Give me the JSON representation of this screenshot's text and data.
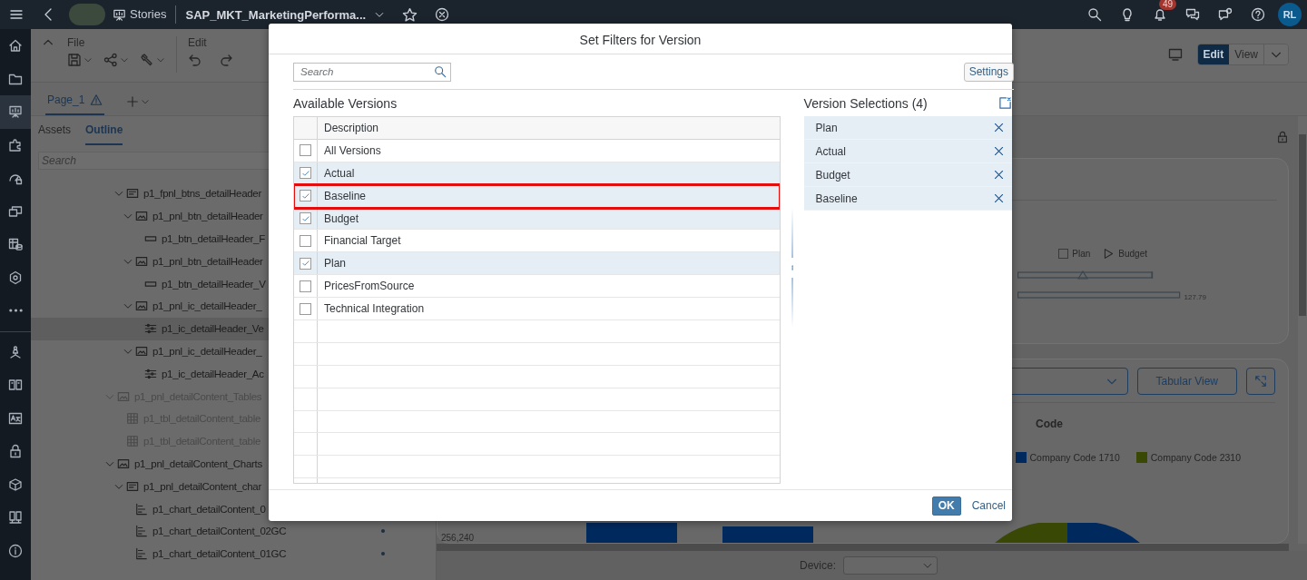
{
  "shell": {
    "section": "Stories",
    "story": "SAP_MKT_MarketingPerforma...",
    "notifications": "49",
    "avatar": "RL"
  },
  "rail": {
    "items": [
      {
        "selected": false
      },
      {
        "selected": false
      },
      {
        "selected": true
      },
      {
        "selected": false
      },
      {
        "selected": false
      },
      {
        "selected": false
      },
      {
        "selected": false
      },
      {
        "selected": false
      },
      {
        "selected": false
      },
      {
        "selected": false
      },
      {
        "selected": false
      },
      {
        "selected": false
      },
      {
        "selected": false
      },
      {
        "selected": false
      },
      {
        "selected": false
      },
      {
        "selected": false
      }
    ]
  },
  "toolbar": {
    "groups": [
      {
        "label": "File"
      },
      {
        "label": "Edit"
      }
    ],
    "modes": [
      {
        "label": "Edit",
        "selected": true
      },
      {
        "label": "View",
        "selected": false
      }
    ]
  },
  "page_tabs": [
    {
      "label": "Page_1",
      "warning": true,
      "selected": true
    }
  ],
  "panel": {
    "tabs": [
      {
        "label": "Assets",
        "selected": false
      },
      {
        "label": "Outline",
        "selected": true
      }
    ],
    "search": {
      "placeholder": "Search"
    },
    "tree": [
      {
        "children": [
          {
            "label": "p1_fpnl_btns_detailHeader",
            "kind": "flexpanel",
            "expanded": true,
            "dimmed": false,
            "selected": false,
            "children": [
              {
                "label": "p1_pnl_btn_detailHeader",
                "kind": "panel",
                "expanded": true,
                "dimmed": false,
                "selected": false,
                "children": [
                  {
                    "label": "p1_btn_detailHeader_F",
                    "kind": "button",
                    "dimmed": false,
                    "selected": false
                  }
                ]
              },
              {
                "label": "p1_pnl_btn_detailHeader",
                "kind": "panel",
                "expanded": true,
                "dimmed": false,
                "selected": false,
                "children": [
                  {
                    "label": "p1_btn_detailHeader_V",
                    "kind": "button",
                    "dimmed": false,
                    "selected": false
                  }
                ]
              },
              {
                "label": "p1_pnl_ic_detailHeader_",
                "kind": "panel",
                "expanded": true,
                "dimmed": false,
                "selected": false,
                "children": [
                  {
                    "label": "p1_ic_detailHeader_Ve",
                    "kind": "control",
                    "dimmed": false,
                    "selected": true
                  }
                ]
              },
              {
                "label": "p1_pnl_ic_detailHeader_",
                "kind": "panel",
                "expanded": true,
                "dimmed": false,
                "selected": false,
                "children": [
                  {
                    "label": "p1_ic_detailHeader_Ac",
                    "kind": "control",
                    "dimmed": false,
                    "selected": false
                  }
                ]
              }
            ]
          }
        ]
      },
      {
        "label": "p1_pnl_detailContent_Tables",
        "kind": "panel",
        "expanded": true,
        "dimmed": true,
        "selected": false,
        "children": [
          {
            "label": "p1_tbl_detailContent_table",
            "kind": "table",
            "dimmed": true,
            "selected": false
          },
          {
            "label": "p1_tbl_detailContent_table",
            "kind": "table",
            "dimmed": true,
            "selected": false
          }
        ]
      },
      {
        "label": "p1_pnl_detailContent_Charts",
        "kind": "panel",
        "expanded": true,
        "dimmed": false,
        "selected": false,
        "children": [
          {
            "label": "p1_pnl_detailContent_char",
            "kind": "flexpanel",
            "expanded": true,
            "dimmed": false,
            "selected": false,
            "children": [
              {
                "label": "p1_chart_detailContent_0",
                "kind": "chart",
                "dimmed": false,
                "selected": false
              },
              {
                "label": "p1_chart_detailContent_02GC",
                "kind": "chart",
                "dimmed": false,
                "selected": false,
                "dot": true
              },
              {
                "label": "p1_chart_detailContent_01GC",
                "kind": "chart",
                "dimmed": false,
                "selected": false,
                "dot": true
              }
            ]
          }
        ]
      }
    ]
  },
  "canvas": {
    "legend": [
      {
        "label": "Plan",
        "kind": "box"
      },
      {
        "label": "Budget",
        "kind": "triangle"
      }
    ],
    "bullet_value": "127.79",
    "view_button": "Tabular View",
    "chart_title": "Code",
    "series": [
      {
        "label": "Company Code 1710",
        "color": "#002a5e"
      },
      {
        "label": "Company Code 2310",
        "color": "#3a4805"
      }
    ],
    "axis_value": "256,240"
  },
  "device": {
    "label": "Device:"
  },
  "dialog": {
    "title": "Set Filters for Version",
    "search": {
      "placeholder": "Search"
    },
    "settings": "Settings",
    "available": {
      "title": "Available Versions",
      "column": "Description",
      "rows": [
        {
          "label": "All Versions",
          "checked": false,
          "highlighted": false
        },
        {
          "label": "Actual",
          "checked": true,
          "highlighted": false
        },
        {
          "label": "Baseline",
          "checked": true,
          "highlighted": true
        },
        {
          "label": "Budget",
          "checked": true,
          "highlighted": false
        },
        {
          "label": "Financial Target",
          "checked": false,
          "highlighted": false
        },
        {
          "label": "Plan",
          "checked": true,
          "highlighted": false
        },
        {
          "label": "PricesFromSource",
          "checked": false,
          "highlighted": false
        },
        {
          "label": "Technical Integration",
          "checked": false,
          "highlighted": false
        }
      ]
    },
    "selections": {
      "title": "Version Selections (4)",
      "items": [
        "Plan",
        "Actual",
        "Budget",
        "Baseline"
      ]
    },
    "buttons": {
      "ok": "OK",
      "cancel": "Cancel"
    }
  }
}
